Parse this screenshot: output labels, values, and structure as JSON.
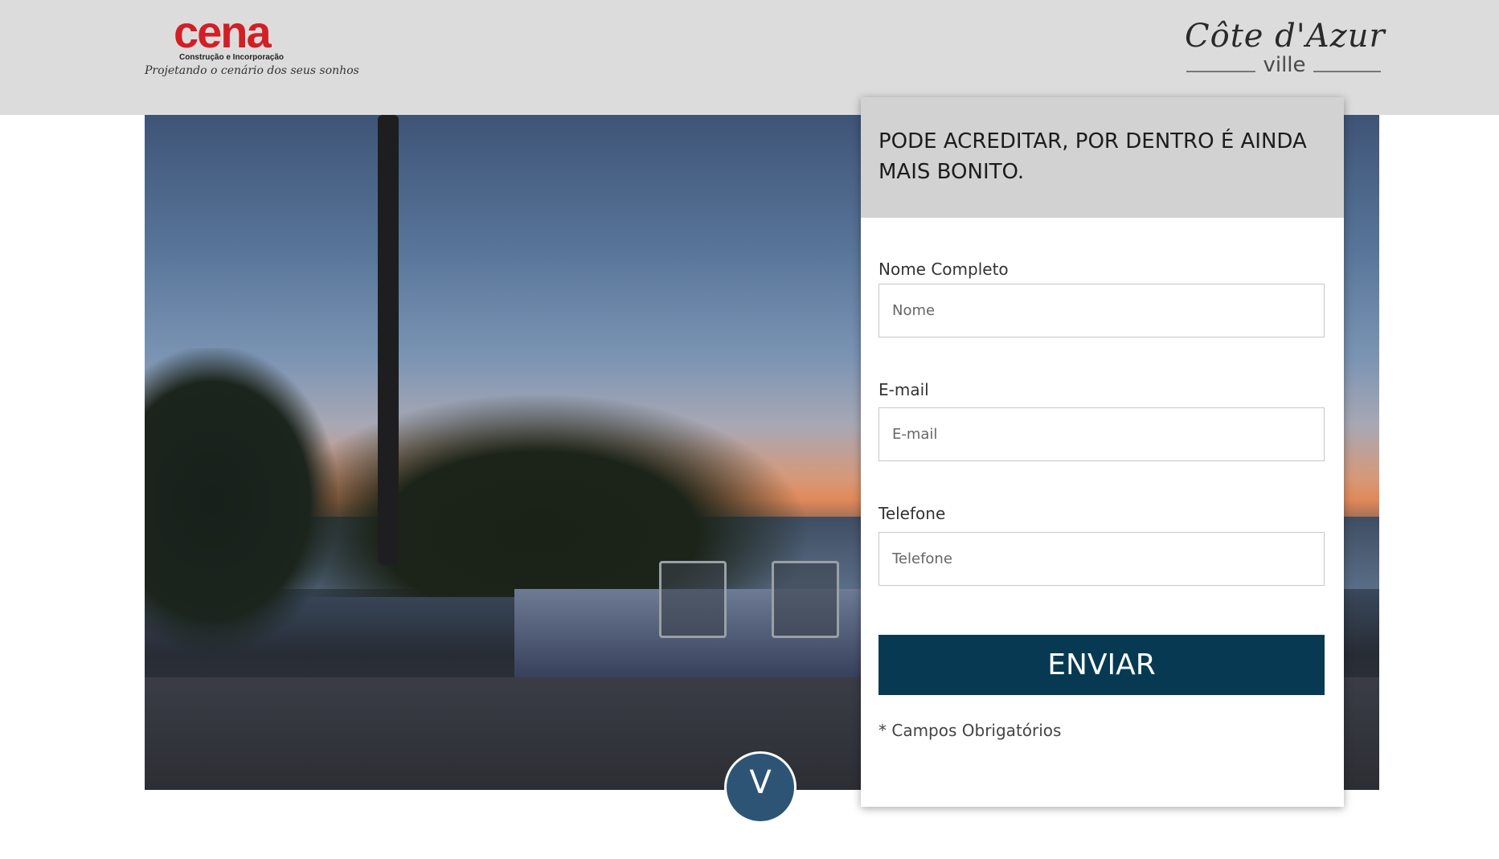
{
  "header": {
    "logo_left": {
      "name": "cena",
      "subtitle": "Construção e Incorporação",
      "tagline": "Projetando o cenário dos seus sonhos",
      "color": "#d11f26"
    },
    "logo_right": {
      "script": "Côte d'Azur",
      "sub": "ville"
    },
    "background": "#dcdcdc"
  },
  "form": {
    "title": "PODE ACREDITAR, POR DENTRO É AINDA MAIS BONITO.",
    "fields": [
      {
        "label": "Nome Completo",
        "placeholder": "Nome",
        "value": ""
      },
      {
        "label": "E-mail",
        "placeholder": "E-mail",
        "value": ""
      },
      {
        "label": "Telefone",
        "placeholder": "Telefone",
        "value": ""
      }
    ],
    "submit_label": "ENVIAR",
    "required_note": "* Campos Obrigatórios",
    "button_color": "#073a52"
  },
  "hero": {
    "scroll_icon": "chevron-down-icon",
    "scroll_glyph": "V",
    "band_color": "#2d5474"
  }
}
